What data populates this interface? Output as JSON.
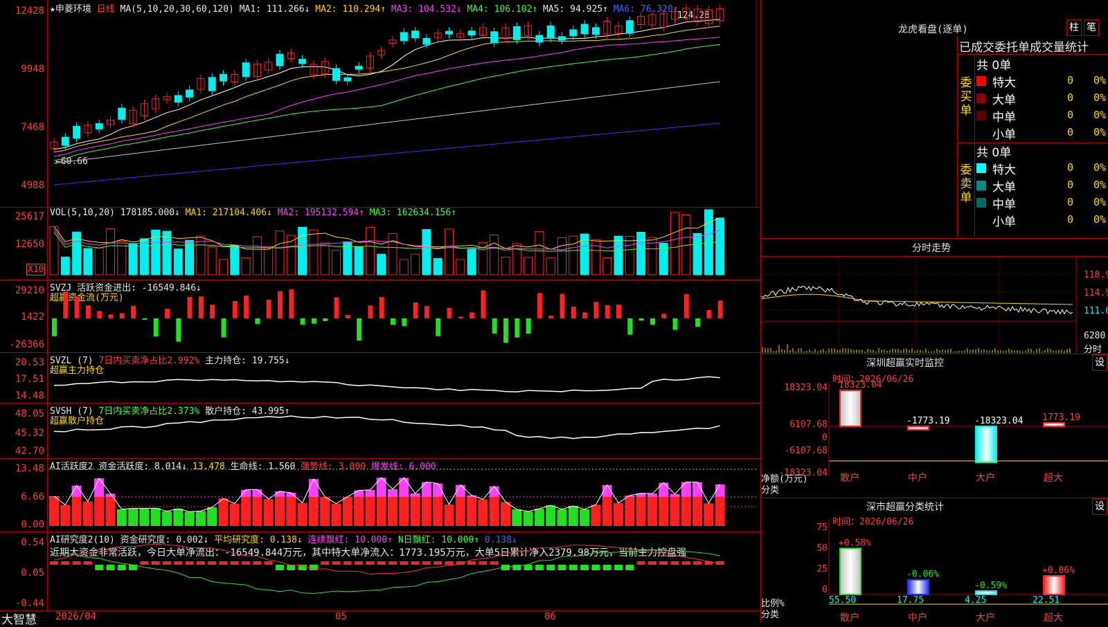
{
  "main": {
    "header": {
      "star": "★",
      "stock_name": "申菱环境",
      "period": "日线",
      "ma_label": "MA(5,10,20,30,60,120)",
      "ma1": "MA1: 111.266↓",
      "ma2": "MA2: 110.294↑",
      "ma3": "MA3: 104.532↓",
      "ma4": "MA4: 106.102↑",
      "ma5": "MA5: 94.925↑",
      "ma6": "MA6: 76.320↑"
    },
    "y_labels": [
      "12428",
      "9948",
      "7468",
      "4988"
    ],
    "high_marker": "124.28",
    "low_marker": "←60.66"
  },
  "vol": {
    "header": {
      "name": "VOL(5,10,20)",
      "value": "178185.000↓",
      "ma1": "MA1: 217104.406↓",
      "ma2": "MA2: 195132.594↑",
      "ma3": "MA3: 162634.156↑"
    },
    "y_labels": [
      "25617",
      "12650"
    ],
    "unit_badge": "X10"
  },
  "svzj": {
    "header": {
      "name": "SVZJ",
      "label": "活跃资金进出: -16549.846↓",
      "sub": "超赢资金流(万元)"
    },
    "y_labels": [
      "29210",
      "1422",
      "-26366"
    ]
  },
  "svzl": {
    "header": {
      "name": "SVZL (7)",
      "ratio": "7日内买卖净占比2.992%",
      "hold": "主力持仓: 19.755↓",
      "sub": "超赢主力持仓"
    },
    "y_labels": [
      "20.53",
      "17.51",
      "14.48"
    ]
  },
  "svsh": {
    "header": {
      "name": "SVSH (7)",
      "ratio": "7日内买卖净占比2.373%",
      "hold": "散户持仓: 43.995↑",
      "sub": "超赢散户持仓"
    },
    "y_labels": [
      "48.05",
      "45.32",
      "42.70"
    ]
  },
  "ai_act": {
    "header": {
      "name": "AI活跃度2",
      "a": "资金活跃度: 8.014↓",
      "b": "13.478",
      "c": "生命线: 1.560",
      "d": "强势线: 3.000",
      "e": "爆发线: 6.000"
    },
    "y_labels": [
      "13.48",
      "6.66",
      "0.00"
    ]
  },
  "ai_res": {
    "header": {
      "name": "AI研究度2(10)",
      "a": "资金研究度: 0.002↓",
      "b": "平均研究度: 0.138↓",
      "c": "连续飘红: 10.000↑",
      "d": "N日飘红: 10.000↑",
      "e": "0.138↓"
    },
    "commentary": "近期大资金非常活跃，今日大单净流出：-16549.844万元，其中特大单净流入：1773.195万元，大单5日累计净入2379.98万元，当前主力控盘强",
    "y_labels": [
      "0.54",
      "0.05",
      "-0.44"
    ]
  },
  "bottom": {
    "app_name": "大智慧",
    "date_start": "2026/04",
    "m05": "05",
    "m06": "06"
  },
  "longhu": {
    "title": "龙虎看盘(逐单)",
    "btn_bar": "柱",
    "btn_stroke": "笔",
    "tabs_line": "已成交委托单成交量统计",
    "buy_group": {
      "side_label": "委买单",
      "total": "共 0单",
      "rows": [
        {
          "label": "特大",
          "count": "0",
          "pct": "0%",
          "color": "#ff0000"
        },
        {
          "label": "大单",
          "count": "0",
          "pct": "0%",
          "color": "#8a0000"
        },
        {
          "label": "中单",
          "count": "0",
          "pct": "0%",
          "color": "#5a0000"
        },
        {
          "label": "小单",
          "count": "0",
          "pct": "0%",
          "color": ""
        }
      ]
    },
    "sell_group": {
      "side_label": "委卖单",
      "total": "共 0单",
      "rows": [
        {
          "label": "特大",
          "count": "0",
          "pct": "0%",
          "color": "#00ffff"
        },
        {
          "label": "大单",
          "count": "0",
          "pct": "0%",
          "color": "#008a8a"
        },
        {
          "label": "中单",
          "count": "0",
          "pct": "0%",
          "color": "#006a6a"
        },
        {
          "label": "小单",
          "count": "0",
          "pct": "0%",
          "color": ""
        }
      ]
    }
  },
  "intraday": {
    "title": "分时走势",
    "right_labels": [
      "118.9",
      "114.9",
      "111.0",
      "6280",
      "分时"
    ]
  },
  "sz_monitor": {
    "title": "深圳超赢实时监控",
    "settings_btn": "设",
    "time_label": "时间：2026/06/26",
    "y_labels": [
      "18323.04",
      "6107.68",
      "0",
      "-6107.68",
      "-18323.04"
    ],
    "unit_label": "净额(万元)",
    "cat_label": "分类",
    "bars": [
      {
        "name": "散户",
        "value": 18323.04,
        "label": "18323.04"
      },
      {
        "name": "中户",
        "value": -1773.19,
        "label": "-1773.19"
      },
      {
        "name": "大户",
        "value": -18323.04,
        "label": "-18323.04"
      },
      {
        "name": "超大",
        "value": 1773.19,
        "label": "1773.19"
      }
    ]
  },
  "sz_stats": {
    "title": "深市超赢分类统计",
    "settings_btn": "设",
    "time_label": "时间：2026/06/26",
    "y_labels": [
      "75",
      "50",
      "25",
      "0"
    ],
    "unit_label": "比例%",
    "cat_label": "分类",
    "bars": [
      {
        "name": "散户",
        "value": 55.5,
        "label": "55.50",
        "delta": "+0.58%"
      },
      {
        "name": "中户",
        "value": 17.75,
        "label": "17.75",
        "delta": "-0.06%"
      },
      {
        "name": "大户",
        "value": 4.25,
        "label": "4.25",
        "delta": "-0.59%"
      },
      {
        "name": "超大",
        "value": 22.51,
        "label": "22.51",
        "delta": "+0.06%"
      }
    ]
  }
}
